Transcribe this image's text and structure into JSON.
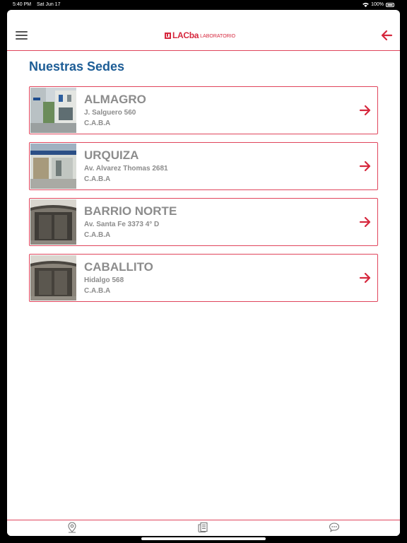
{
  "status_bar": {
    "time": "5:40 PM",
    "date": "Sat Jun 17",
    "battery": "100%"
  },
  "header": {
    "logo_lac": "LAC",
    "logo_ba": "ba",
    "logo_subtitle": "LABORATORIO"
  },
  "page_title": "Nuestras Sedes",
  "colors": {
    "accent": "#d6273d",
    "title": "#1d5d96",
    "text_muted": "#8c8c8c"
  },
  "sedes": [
    {
      "name": "ALMAGRO",
      "address": "J. Salguero 560",
      "city": "C.A.B.A"
    },
    {
      "name": "URQUIZA",
      "address": "Av. Alvarez Thomas 2681",
      "city": "C.A.B.A"
    },
    {
      "name": "BARRIO NORTE",
      "address": "Av. Santa Fe 3373 4° D",
      "city": "C.A.B.A"
    },
    {
      "name": "CABALLITO",
      "address": "Hidalgo 568",
      "city": "C.A.B.A"
    }
  ],
  "tabs": [
    {
      "icon": "location-pin-icon"
    },
    {
      "icon": "results-document-icon"
    },
    {
      "icon": "chat-bubble-icon"
    }
  ]
}
